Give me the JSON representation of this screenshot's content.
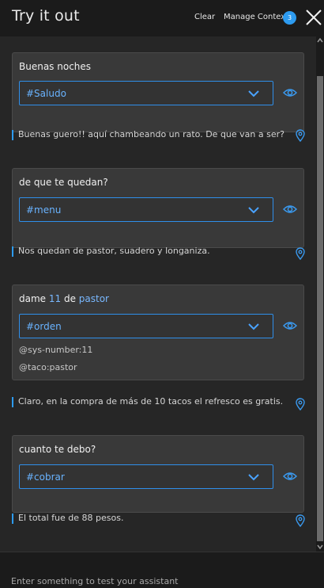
{
  "header": {
    "title": "Try it out",
    "clear_label": "Clear",
    "manage_context_label": "Manage Context",
    "context_count": "3"
  },
  "conversation": [
    {
      "user": {
        "prefix": "Buenas noches"
      },
      "intent": "#Saludo",
      "entities": [],
      "response": "Buenas guero!! aquí chambeando un rato. De que van a ser?"
    },
    {
      "user": {
        "prefix": "de que te quedan?"
      },
      "intent": "#menu",
      "entities": [],
      "response": "Nos quedan de pastor, suadero y longaniza."
    },
    {
      "user": {
        "prefix": "dame ",
        "number": "11",
        "middle": " de ",
        "entity": "pastor"
      },
      "intent": "#orden",
      "entities": [
        "@sys-number:11",
        "@taco:pastor"
      ],
      "response": "Claro, en la compra de más de 10 tacos el refresco es gratis."
    },
    {
      "user": {
        "prefix": "cuanto te debo?"
      },
      "intent": "#cobrar",
      "entities": [],
      "response": "El total fue de 88 pesos."
    }
  ],
  "input": {
    "placeholder": "Enter something to test your assistant"
  },
  "colors": {
    "accent": "#2d9bf0",
    "intent_text": "#69b3ff",
    "card_bg": "#393939"
  }
}
